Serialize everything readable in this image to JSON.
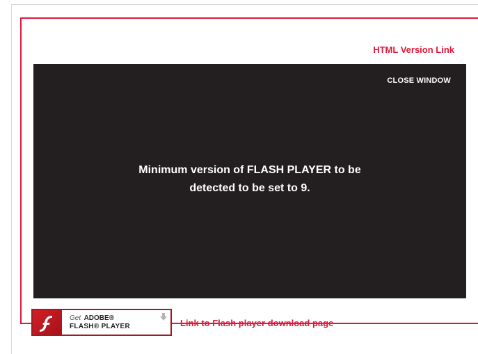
{
  "links": {
    "html_version": "HTML Version Link",
    "flash_download": "Link to Flash player download page"
  },
  "stage": {
    "close_label": "CLOSE WINDOW",
    "message_line1": "Minimum version of FLASH PLAYER to be",
    "message_line2": "detected to be set to 9."
  },
  "flash_badge": {
    "get": "Get",
    "adobe": "ADOBE®",
    "product": "FLASH® PLAYER",
    "logo_icon": "flash-f-logo",
    "arrow_icon": "download-arrow"
  },
  "colors": {
    "accent": "#e0183a",
    "stage_bg": "#231f20",
    "badge_border": "#9e1b24"
  }
}
